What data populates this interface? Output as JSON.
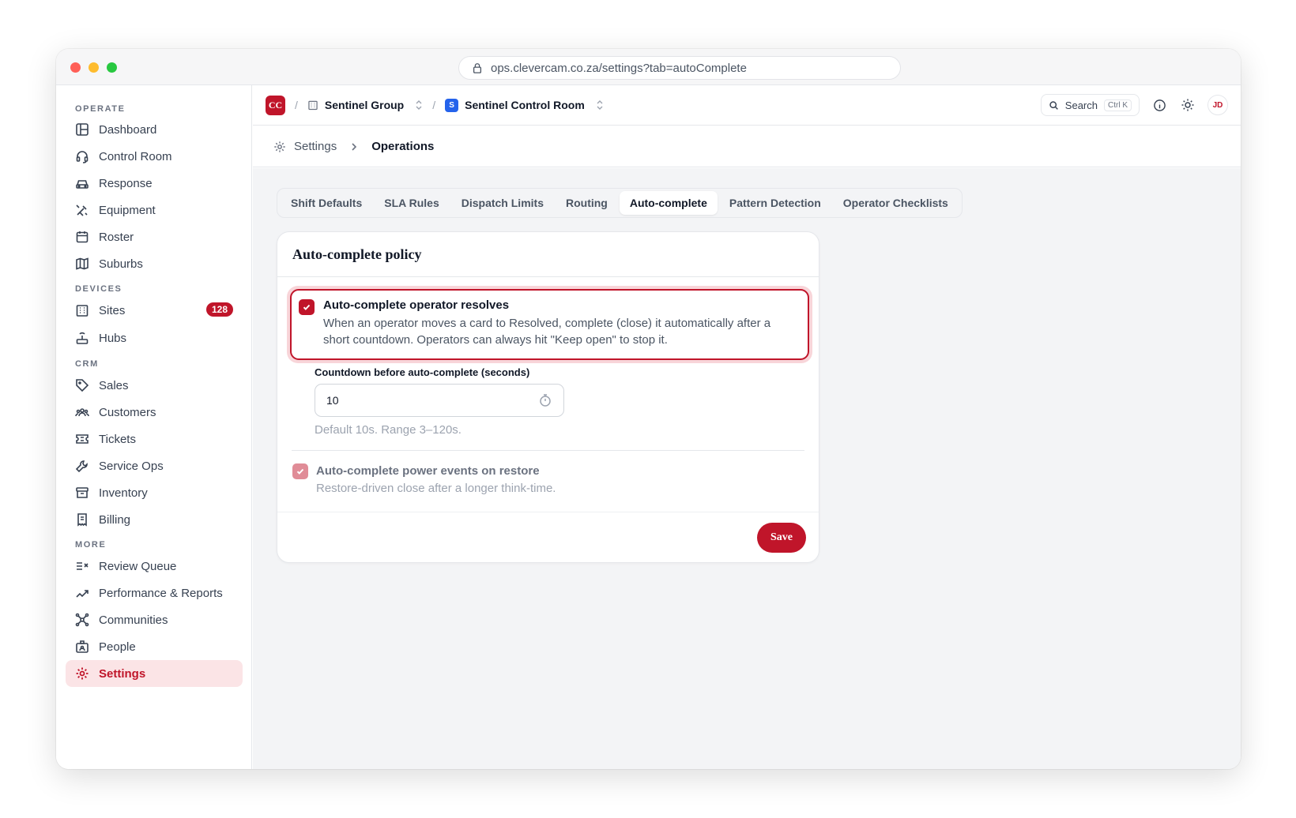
{
  "browser": {
    "url": "ops.clevercam.co.za/settings?tab=autoComplete"
  },
  "sidebar": {
    "sections": [
      {
        "label": "OPERATE"
      },
      {
        "label": "DEVICES"
      },
      {
        "label": "CRM"
      },
      {
        "label": "MORE"
      }
    ],
    "items": [
      {
        "label": "Dashboard",
        "icon": "dashboard-icon"
      },
      {
        "label": "Control Room",
        "icon": "headset-icon"
      },
      {
        "label": "Response",
        "icon": "car-icon"
      },
      {
        "label": "Equipment",
        "icon": "tools-icon"
      },
      {
        "label": "Roster",
        "icon": "calendar-icon"
      },
      {
        "label": "Suburbs",
        "icon": "map-icon"
      },
      {
        "label": "Sites",
        "icon": "building-icon",
        "badge": "128"
      },
      {
        "label": "Hubs",
        "icon": "router-icon"
      },
      {
        "label": "Sales",
        "icon": "tag-icon"
      },
      {
        "label": "Customers",
        "icon": "users-icon"
      },
      {
        "label": "Tickets",
        "icon": "ticket-icon"
      },
      {
        "label": "Service Ops",
        "icon": "wrench-icon"
      },
      {
        "label": "Inventory",
        "icon": "archive-icon"
      },
      {
        "label": "Billing",
        "icon": "receipt-icon"
      },
      {
        "label": "Review Queue",
        "icon": "list-check-icon"
      },
      {
        "label": "Performance & Reports",
        "icon": "trend-icon"
      },
      {
        "label": "Communities",
        "icon": "network-icon"
      },
      {
        "label": "People",
        "icon": "id-card-icon"
      },
      {
        "label": "Settings",
        "icon": "gear-icon",
        "active": true
      }
    ]
  },
  "topbar": {
    "logo": "CC",
    "org": "Sentinel Group",
    "room_badge": "S",
    "room": "Sentinel Control Room",
    "search_label": "Search",
    "search_shortcut": "Ctrl K",
    "avatar": "JD"
  },
  "page": {
    "breadcrumb_root": "Settings",
    "breadcrumb_current": "Operations"
  },
  "tabs": [
    {
      "label": "Shift Defaults"
    },
    {
      "label": "SLA Rules"
    },
    {
      "label": "Dispatch Limits"
    },
    {
      "label": "Routing"
    },
    {
      "label": "Auto-complete",
      "active": true
    },
    {
      "label": "Pattern Detection"
    },
    {
      "label": "Operator Checklists"
    }
  ],
  "card": {
    "title": "Auto-complete policy",
    "option1": {
      "title": "Auto-complete operator resolves",
      "desc": "When an operator moves a card to Resolved, complete (close) it automatically after a short countdown. Operators can always hit \"Keep open\" to stop it.",
      "checked": true
    },
    "countdown": {
      "label": "Countdown before auto-complete (seconds)",
      "value": "10",
      "help": "Default 10s. Range 3–120s."
    },
    "option2": {
      "title": "Auto-complete power events on restore",
      "desc": "Restore-driven close after a longer think-time.",
      "checked": true
    },
    "save_label": "Save"
  },
  "colors": {
    "accent": "#c0152a",
    "accent_soft": "#fbe4e6"
  }
}
